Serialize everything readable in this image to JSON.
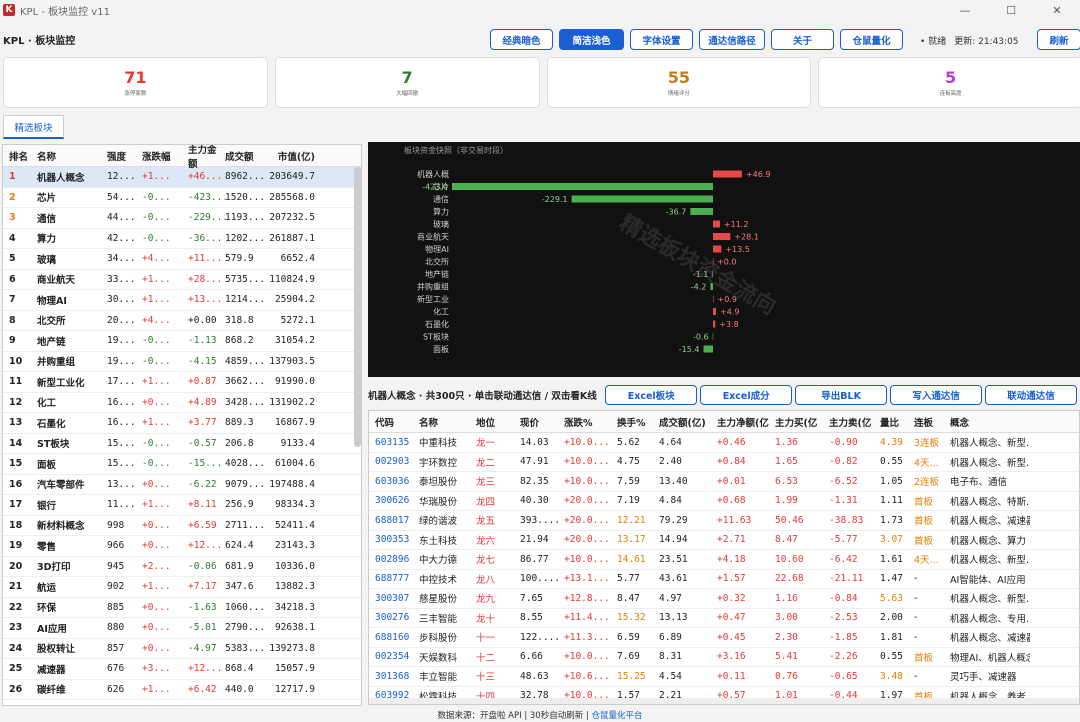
{
  "window": {
    "title": "KPL - 板块监控 v11",
    "app_title": "KPL · 板块监控"
  },
  "toolbar": {
    "buttons": [
      "经典暗色",
      "简洁浅色",
      "字体设置",
      "通达信路径",
      "关于",
      "仓鼠量化"
    ],
    "active": "简洁浅色",
    "status_dot": "•",
    "status": "就绪",
    "update_time": "更新: 21:43:05",
    "refresh": "刷新"
  },
  "cards": [
    {
      "value": "71",
      "label": "涨停家数",
      "color": "#e53935"
    },
    {
      "value": "7",
      "label": "大幅回撤",
      "color": "#2e7d32"
    },
    {
      "value": "55",
      "label": "情绪评分",
      "color": "#c77b15"
    },
    {
      "value": "5",
      "label": "连板高度",
      "color": "#b03fd8"
    }
  ],
  "tab": {
    "label": "精选板块"
  },
  "left_table": {
    "headers": [
      "排名",
      "名称",
      "强度",
      "涨跌幅",
      "主力金额",
      "成交额",
      "市值(亿)"
    ],
    "rows": [
      [
        "1",
        "机器人概念",
        "12...",
        "+1...",
        "+46...",
        "8962...",
        "203649.7"
      ],
      [
        "2",
        "芯片",
        "54...",
        "-0...",
        "-423...",
        "1520...",
        "285568.0"
      ],
      [
        "3",
        "通信",
        "44...",
        "-0...",
        "-229...",
        "1193...",
        "207232.5"
      ],
      [
        "4",
        "算力",
        "42...",
        "-0...",
        "-36...",
        "1202...",
        "261887.1"
      ],
      [
        "5",
        "玻璃",
        "34...",
        "+4...",
        "+11...",
        "579.9",
        "6652.4"
      ],
      [
        "6",
        "商业航天",
        "33...",
        "+1...",
        "+28...",
        "5735...",
        "110824.9"
      ],
      [
        "7",
        "物理AI",
        "30...",
        "+1...",
        "+13...",
        "1214...",
        "25904.2"
      ],
      [
        "8",
        "北交所",
        "20...",
        "+4...",
        "+0.00",
        "318.8",
        "5272.1"
      ],
      [
        "9",
        "地产链",
        "19...",
        "-0...",
        "-1.13",
        "868.2",
        "31054.2"
      ],
      [
        "10",
        "并购重组",
        "19...",
        "-0...",
        "-4.15",
        "4859...",
        "137903.5"
      ],
      [
        "11",
        "新型工业化",
        "17...",
        "+1...",
        "+0.87",
        "3662...",
        "91990.0"
      ],
      [
        "12",
        "化工",
        "16...",
        "+0...",
        "+4.89",
        "3428...",
        "131902.2"
      ],
      [
        "13",
        "石墨化",
        "16...",
        "+1...",
        "+3.77",
        "889.3",
        "16867.9"
      ],
      [
        "14",
        "ST板块",
        "15...",
        "-0...",
        "-0.57",
        "206.8",
        "9133.4"
      ],
      [
        "15",
        "面板",
        "15...",
        "-0...",
        "-15...",
        "4028...",
        "61004.6"
      ],
      [
        "16",
        "汽车零部件",
        "13...",
        "+0...",
        "-6.22",
        "9079...",
        "197488.4"
      ],
      [
        "17",
        "银行",
        "11...",
        "+1...",
        "+8.11",
        "256.9",
        "98334.3"
      ],
      [
        "18",
        "新材料概念",
        "998",
        "+0...",
        "+6.59",
        "2711...",
        "52411.4"
      ],
      [
        "19",
        "零售",
        "966",
        "+0...",
        "+12...",
        "624.4",
        "23143.3"
      ],
      [
        "20",
        "3D打印",
        "945",
        "+2...",
        "-0.06",
        "681.9",
        "10336.0"
      ],
      [
        "21",
        "航运",
        "902",
        "+1...",
        "+7.17",
        "347.6",
        "13882.3"
      ],
      [
        "22",
        "环保",
        "885",
        "+0...",
        "-1.63",
        "1060...",
        "34218.3"
      ],
      [
        "23",
        "AI应用",
        "880",
        "+0...",
        "-5.01",
        "2790...",
        "92638.1"
      ],
      [
        "24",
        "股权转让",
        "857",
        "+0...",
        "-4.97",
        "5383...",
        "139273.8"
      ],
      [
        "25",
        "减速器",
        "676",
        "+3...",
        "+12...",
        "868.4",
        "15057.9"
      ],
      [
        "26",
        "碳纤维",
        "626",
        "+1...",
        "+6.42",
        "440.0",
        "12717.9"
      ]
    ]
  },
  "chart_data": {
    "type": "bar",
    "title": "板块资金快照（非交易时段）",
    "watermark": "精选板块资金流向",
    "categories": [
      "机器人概",
      "芯片",
      "通信",
      "算力",
      "玻璃",
      "商业航天",
      "物理AI",
      "北交所",
      "地产链",
      "并购重组",
      "新型工业",
      "化工",
      "石墨化",
      "ST板块",
      "面板"
    ],
    "values": [
      46.9,
      -423.0,
      -229.1,
      -36.7,
      11.2,
      28.1,
      13.5,
      0.0,
      -1.1,
      -4.2,
      0.9,
      4.9,
      3.8,
      -0.6,
      -15.4
    ],
    "value_labels": [
      "+46.9",
      "-423.0",
      "-229.1",
      "-36.7",
      "+11.2",
      "+28.1",
      "+13.5",
      "+0.0",
      "-1.1",
      "-4.2",
      "+0.9",
      "+4.9",
      "+3.8",
      "-0.6",
      "-15.4"
    ],
    "colors": {
      "pos": "#e5474a",
      "neg": "#4caf50"
    }
  },
  "mid": {
    "label": "机器人概念 · 共300只 · 单击联动通达信 / 双击看K线",
    "buttons": [
      "Excel板块",
      "Excel成分",
      "导出BLK",
      "写入通达信",
      "联动通达信"
    ]
  },
  "right_table": {
    "headers": [
      "代码",
      "名称",
      "地位",
      "现价",
      "涨跌%",
      "换手%",
      "成交额(亿)",
      "主力净额(亿",
      "主力买(亿",
      "主力卖(亿",
      "量比",
      "连板",
      "概念"
    ],
    "rows": [
      [
        "603135",
        "中重科技",
        "龙一",
        "14.03",
        "+10.0...",
        "5.62",
        "4.64",
        "+0.46",
        "1.36",
        "-0.90",
        "4.39",
        "3连板",
        "机器人概念、新型..."
      ],
      [
        "002903",
        "宇环数控",
        "龙二",
        "47.91",
        "+10.0...",
        "4.75",
        "2.40",
        "+0.84",
        "1.65",
        "-0.82",
        "0.55",
        "4天...",
        "机器人概念、新型..."
      ],
      [
        "603036",
        "泰坦股份",
        "龙三",
        "82.35",
        "+10.0...",
        "7.59",
        "13.40",
        "+0.01",
        "6.53",
        "-6.52",
        "1.05",
        "2连板",
        "电子布、通信"
      ],
      [
        "300626",
        "华瑞股份",
        "龙四",
        "40.30",
        "+20.0...",
        "7.19",
        "4.84",
        "+0.68",
        "1.99",
        "-1.31",
        "1.11",
        "首板",
        "机器人概念、特斯..."
      ],
      [
        "688017",
        "绿的谐波",
        "龙五",
        "393....",
        "+20.0...",
        "12.21",
        "79.29",
        "+11.63",
        "50.46",
        "-38.83",
        "1.73",
        "首板",
        "机器人概念、减速器"
      ],
      [
        "300353",
        "东土科技",
        "龙六",
        "21.94",
        "+20.0...",
        "13.17",
        "14.94",
        "+2.71",
        "8.47",
        "-5.77",
        "3.07",
        "首板",
        "机器人概念、算力"
      ],
      [
        "002896",
        "中大力德",
        "龙七",
        "86.77",
        "+10.0...",
        "14.61",
        "23.51",
        "+4.18",
        "10.60",
        "-6.42",
        "1.61",
        "4天...",
        "机器人概念、新型..."
      ],
      [
        "688777",
        "中控技术",
        "龙八",
        "100....",
        "+13.1...",
        "5.77",
        "43.61",
        "+1.57",
        "22.68",
        "-21.11",
        "1.47",
        "-",
        "AI智能体、AI应用"
      ],
      [
        "300307",
        "慈星股份",
        "龙九",
        "7.65",
        "+12.8...",
        "8.47",
        "4.97",
        "+0.32",
        "1.16",
        "-0.84",
        "5.63",
        "-",
        "机器人概念、新型..."
      ],
      [
        "300276",
        "三丰智能",
        "龙十",
        "8.55",
        "+11.4...",
        "15.32",
        "13.13",
        "+0.47",
        "3.00",
        "-2.53",
        "2.00",
        "-",
        "机器人概念、专用..."
      ],
      [
        "688160",
        "步科股份",
        "十一",
        "122....",
        "+11.3...",
        "6.59",
        "6.89",
        "+0.45",
        "2.30",
        "-1.85",
        "1.81",
        "-",
        "机器人概念、减速器"
      ],
      [
        "002354",
        "天娱数科",
        "十二",
        "6.66",
        "+10.0...",
        "7.69",
        "8.31",
        "+3.16",
        "5.41",
        "-2.26",
        "0.55",
        "首板",
        "物理AI、机器人概念"
      ],
      [
        "301368",
        "丰立智能",
        "十三",
        "48.63",
        "+10.6...",
        "15.25",
        "4.54",
        "+0.11",
        "0.76",
        "-0.65",
        "3.48",
        "-",
        "灵巧手、减速器"
      ],
      [
        "603992",
        "松霖科技",
        "十四",
        "32.78",
        "+10.0...",
        "1.57",
        "2.21",
        "+0.57",
        "1.01",
        "-0.44",
        "1.97",
        "首板",
        "机器人概念、养老..."
      ]
    ]
  },
  "footer": {
    "text": "数据来源：开盘啦 API | 30秒自动刷新 | ",
    "link": "仓鼠量化平台"
  }
}
